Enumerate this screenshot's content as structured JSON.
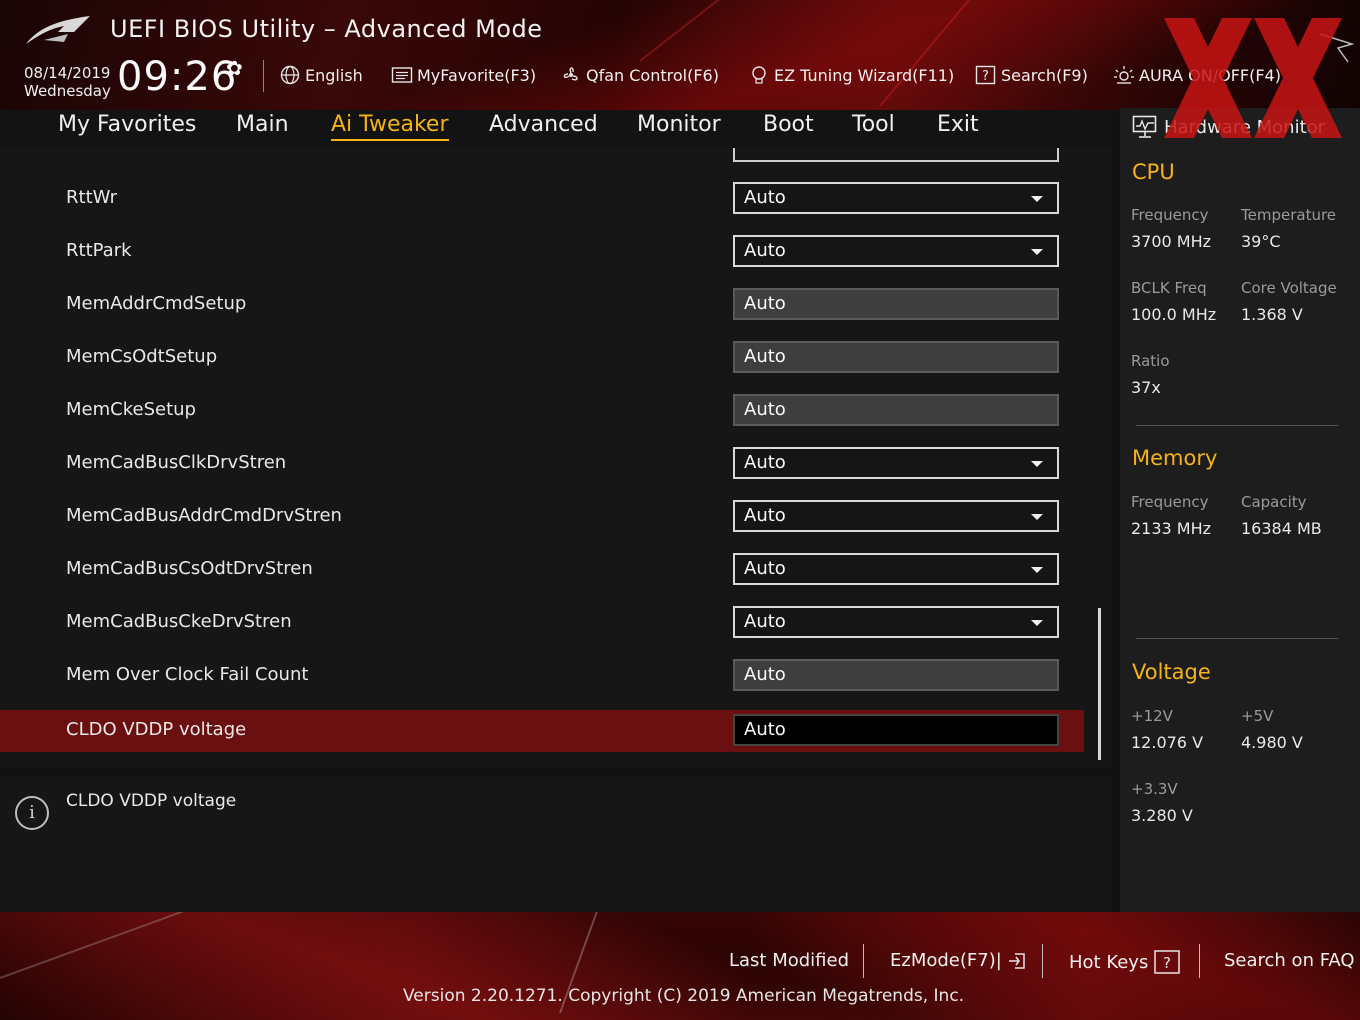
{
  "header": {
    "title": "UEFI BIOS Utility – Advanced Mode",
    "date": "08/14/2019",
    "weekday": "Wednesday",
    "time": "09:26",
    "tools": {
      "language": "English",
      "favorite": "MyFavorite(F3)",
      "qfan": "Qfan Control(F6)",
      "ez_tuning": "EZ Tuning Wizard(F11)",
      "search": "Search(F9)",
      "aura": "AURA ON/OFF(F4)"
    }
  },
  "nav": {
    "tabs": [
      "My Favorites",
      "Main",
      "Ai Tweaker",
      "Advanced",
      "Monitor",
      "Boot",
      "Tool",
      "Exit"
    ],
    "active": "Ai Tweaker"
  },
  "settings": {
    "rows": [
      {
        "label": "RttWr",
        "value": "Auto",
        "type": "dropdown"
      },
      {
        "label": "RttPark",
        "value": "Auto",
        "type": "dropdown"
      },
      {
        "label": "MemAddrCmdSetup",
        "value": "Auto",
        "type": "textbox"
      },
      {
        "label": "MemCsOdtSetup",
        "value": "Auto",
        "type": "textbox"
      },
      {
        "label": "MemCkeSetup",
        "value": "Auto",
        "type": "textbox"
      },
      {
        "label": "MemCadBusClkDrvStren",
        "value": "Auto",
        "type": "dropdown"
      },
      {
        "label": "MemCadBusAddrCmdDrvStren",
        "value": "Auto",
        "type": "dropdown"
      },
      {
        "label": "MemCadBusCsOdtDrvStren",
        "value": "Auto",
        "type": "dropdown"
      },
      {
        "label": "MemCadBusCkeDrvStren",
        "value": "Auto",
        "type": "dropdown"
      },
      {
        "label": "Mem Over Clock Fail Count",
        "value": "Auto",
        "type": "textbox"
      },
      {
        "label": "CLDO VDDP voltage",
        "value": "Auto",
        "type": "edit",
        "selected": true
      }
    ]
  },
  "help": {
    "text": "CLDO VDDP voltage"
  },
  "hw_monitor": {
    "title": "Hardware Monitor",
    "cpu": {
      "heading": "CPU",
      "frequency_label": "Frequency",
      "frequency": "3700 MHz",
      "temperature_label": "Temperature",
      "temperature": "39°C",
      "bclk_label": "BCLK Freq",
      "bclk": "100.0 MHz",
      "core_voltage_label": "Core Voltage",
      "core_voltage": "1.368 V",
      "ratio_label": "Ratio",
      "ratio": "37x"
    },
    "memory": {
      "heading": "Memory",
      "frequency_label": "Frequency",
      "frequency": "2133 MHz",
      "capacity_label": "Capacity",
      "capacity": "16384 MB"
    },
    "voltage": {
      "heading": "Voltage",
      "v12_label": "+12V",
      "v12": "12.076 V",
      "v5_label": "+5V",
      "v5": "4.980 V",
      "v33_label": "+3.3V",
      "v33": "3.280 V"
    }
  },
  "footer": {
    "last_modified": "Last Modified",
    "ezmode": "EzMode(F7)|",
    "hotkeys": "Hot Keys",
    "faq": "Search on FAQ",
    "version": "Version 2.20.1271. Copyright (C) 2019 American Megatrends, Inc."
  },
  "colors": {
    "accent": "#f4b21b",
    "selected_row": "#6b1010",
    "watermark": "#c81414"
  }
}
